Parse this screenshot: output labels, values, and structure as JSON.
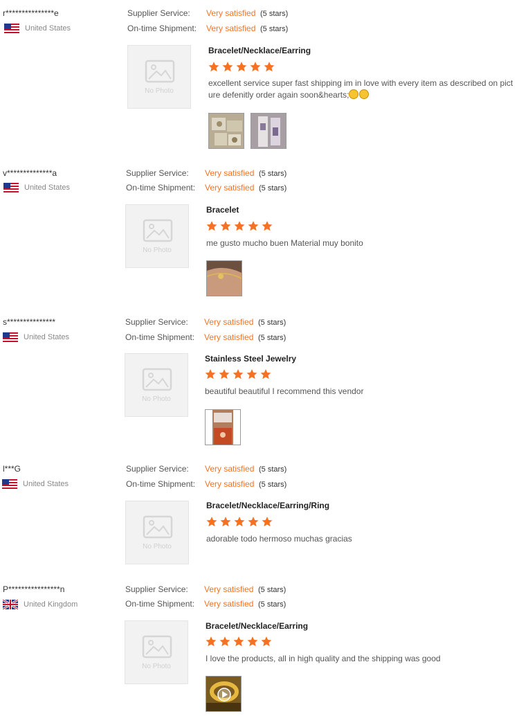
{
  "reviews": [
    {
      "reviewer": "r***************e",
      "country": "United States",
      "flag": "us-flag",
      "supplier_service_label": "Supplier Service:",
      "supplier_service_value": "Very satisfied",
      "supplier_service_stars": "(5 stars)",
      "shipment_label": "On-time Shipment:",
      "shipment_value": "Very satisfied",
      "shipment_stars": "(5 stars)",
      "no_photo": "No Photo",
      "product": "Bracelet/Necklace/Earring",
      "rating": 5,
      "comment": "excellent service super fast shipping im in love with every item as described on picture defenitly order again soon&hearts;",
      "emojis": [
        "hugging-face-emoji",
        "hugging-face-emoji"
      ],
      "photos": [
        "jewelry-bags-photo",
        "jewelry-cards-photo"
      ]
    },
    {
      "reviewer": "v**************a",
      "country": "United States",
      "flag": "us-flag",
      "supplier_service_label": "Supplier Service:",
      "supplier_service_value": "Very satisfied",
      "supplier_service_stars": "(5 stars)",
      "shipment_label": "On-time Shipment:",
      "shipment_value": "Very satisfied",
      "shipment_stars": "(5 stars)",
      "no_photo": "No Photo",
      "product": "Bracelet",
      "rating": 5,
      "comment": "me gusto mucho buen Material muy bonito",
      "photos": [
        "bracelet-on-wrist-photo"
      ]
    },
    {
      "reviewer": "s***************",
      "country": "United States",
      "flag": "us-flag",
      "supplier_service_label": "Supplier Service:",
      "supplier_service_value": "Very satisfied",
      "supplier_service_stars": "(5 stars)",
      "shipment_label": "On-time Shipment:",
      "shipment_value": "Very satisfied",
      "shipment_stars": "(5 stars)",
      "no_photo": "No Photo",
      "product": "Stainless Steel Jewelry",
      "rating": 5,
      "comment": "beautiful beautiful I recommend this vendor",
      "photos": [
        "jewelry-package-photo"
      ]
    },
    {
      "reviewer": "l***G",
      "country": "United States",
      "flag": "us-flag",
      "supplier_service_label": "Supplier Service:",
      "supplier_service_value": "Very satisfied",
      "supplier_service_stars": "(5 stars)",
      "shipment_label": "On-time Shipment:",
      "shipment_value": "Very satisfied",
      "shipment_stars": "(5 stars)",
      "no_photo": "No Photo",
      "product": "Bracelet/Necklace/Earring/Ring",
      "rating": 5,
      "comment": "adorable todo hermoso muchas gracias",
      "photos": []
    },
    {
      "reviewer": "P****************n",
      "country": "United Kingdom",
      "flag": "uk-flag",
      "supplier_service_label": "Supplier Service:",
      "supplier_service_value": "Very satisfied",
      "supplier_service_stars": "(5 stars)",
      "shipment_label": "On-time Shipment:",
      "shipment_value": "Very satisfied",
      "shipment_stars": "(5 stars)",
      "no_photo": "No Photo",
      "product": "Bracelet/Necklace/Earring",
      "rating": 5,
      "comment": "I love the products, all in high quality and the shipping was good",
      "photos": [
        "gold-ring-video-thumbnail"
      ]
    }
  ],
  "colors": {
    "accent": "#f57224",
    "star": "#f57224",
    "muted": "#888888"
  }
}
